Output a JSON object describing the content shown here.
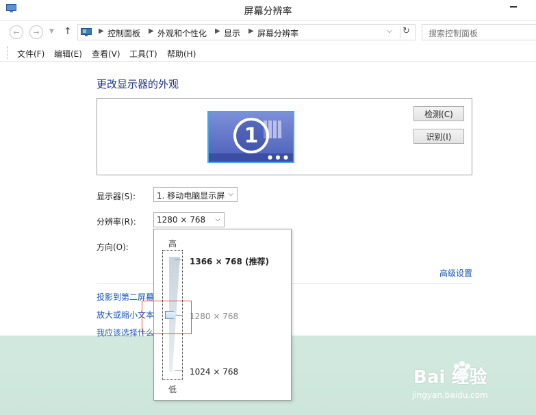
{
  "window": {
    "title": "屏幕分辨率"
  },
  "address": {
    "crumbs": [
      "控制面板",
      "外观和个性化",
      "显示",
      "屏幕分辨率"
    ],
    "search_placeholder": "搜索控制面板"
  },
  "menu": {
    "items": [
      "文件(F)",
      "编辑(E)",
      "查看(V)",
      "工具(T)",
      "帮助(H)"
    ]
  },
  "main": {
    "heading": "更改显示器的外观",
    "monitor_number": "1",
    "detect_button": "检测(C)",
    "identify_button": "识别(I)",
    "display_label": "显示器(S):",
    "display_value": "1. 移动电脑显示屏",
    "resolution_label": "分辨率(R):",
    "resolution_value": "1280 × 768",
    "orientation_label": "方向(O):",
    "advanced_link": "高级设置",
    "links": [
      "投影到第二屏幕",
      "放大或缩小文本",
      "我应该选择什么"
    ]
  },
  "resolution_popup": {
    "high_label": "高",
    "low_label": "低",
    "options": [
      "1366 × 768 (推荐)",
      "1280 × 768",
      "1024 × 768"
    ],
    "selected_index": 1
  },
  "watermark": {
    "brand": "Bai 经验",
    "sub": "jingyan.baidu.com"
  },
  "colors": {
    "link": "#1a56b5",
    "heading": "#1e3287",
    "highlight_box": "#e34a4a"
  }
}
